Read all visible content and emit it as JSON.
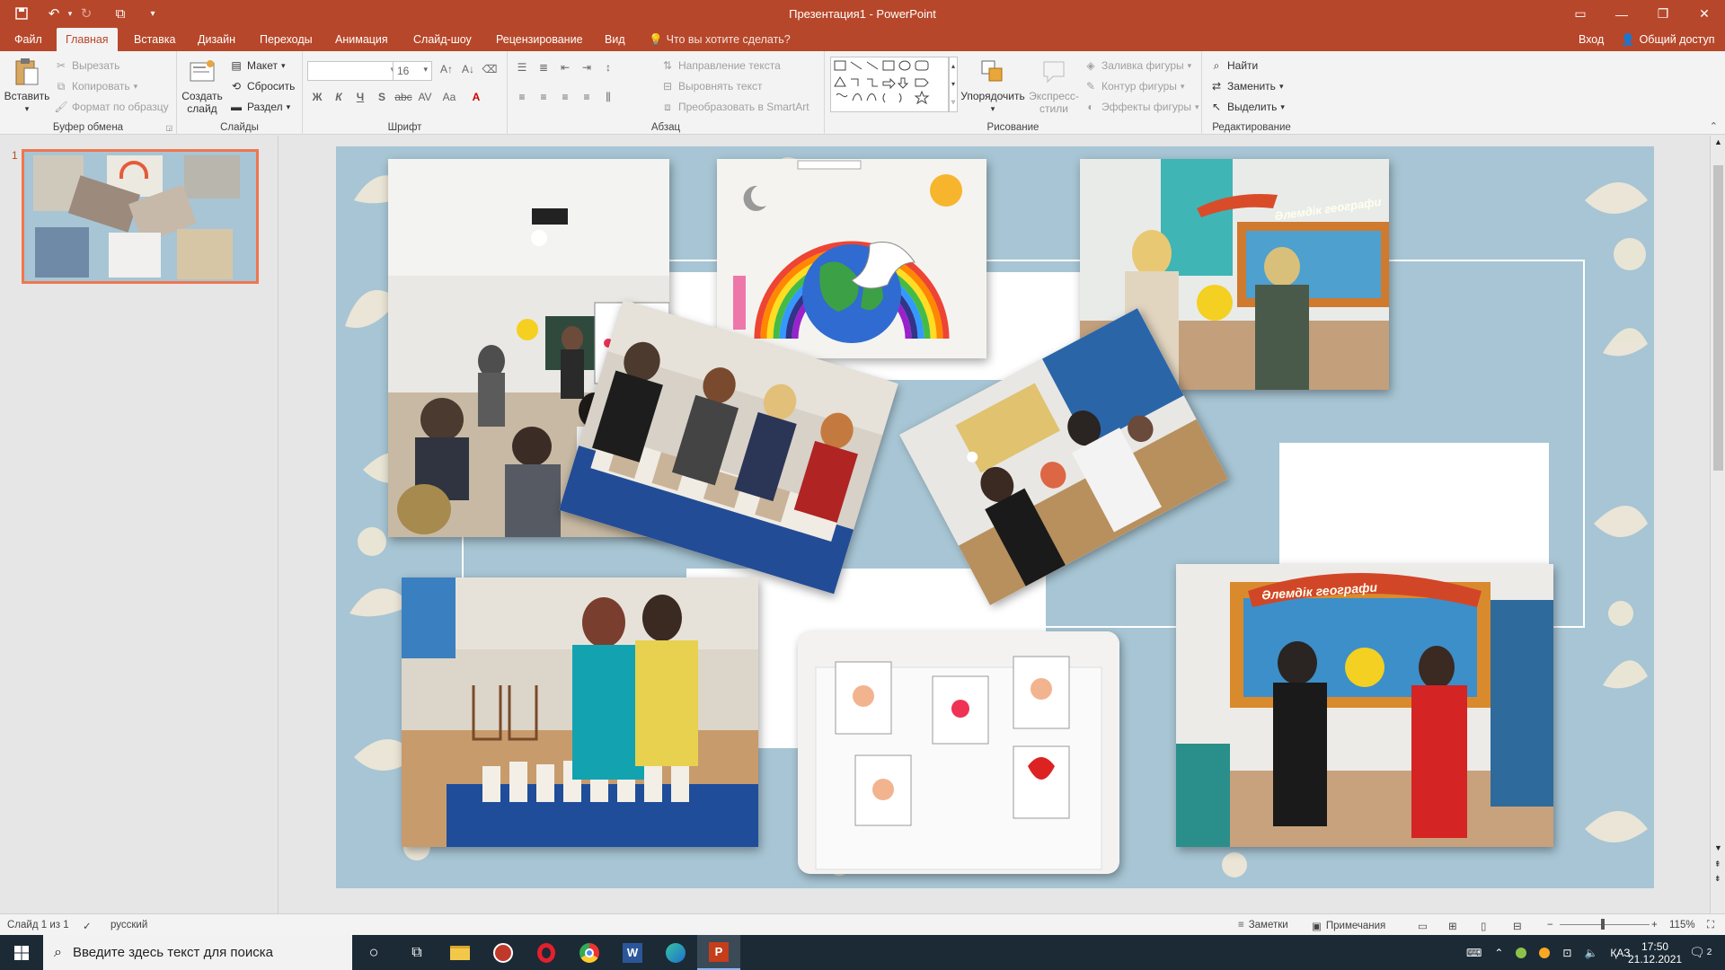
{
  "titlebar": {
    "title": "Презентация1 - PowerPoint"
  },
  "tabs": [
    {
      "label": "Файл"
    },
    {
      "label": "Главная"
    },
    {
      "label": "Вставка"
    },
    {
      "label": "Дизайн"
    },
    {
      "label": "Переходы"
    },
    {
      "label": "Анимация"
    },
    {
      "label": "Слайд-шоу"
    },
    {
      "label": "Рецензирование"
    },
    {
      "label": "Вид"
    }
  ],
  "tellme": "Что вы хотите сделать?",
  "account": {
    "signin": "Вход",
    "share": "Общий доступ"
  },
  "clipboard": {
    "paste": "Вставить",
    "cut": "Вырезать",
    "copy": "Копировать",
    "painter": "Формат по образцу",
    "label": "Буфер обмена"
  },
  "slides": {
    "new_line1": "Создать",
    "new_line2": "слайд",
    "layout": "Макет",
    "reset": "Сбросить",
    "section": "Раздел",
    "label": "Слайды"
  },
  "font": {
    "size": "16",
    "label": "Шрифт",
    "bold": "Ж",
    "italic": "К",
    "underline": "Ч",
    "strike": "S",
    "abc": "abc",
    "spacing": "AV",
    "case": "Aa",
    "color": "A"
  },
  "paragraph": {
    "direction": "Направление текста",
    "align": "Выровнять текст",
    "smartart": "Преобразовать в SmartArt",
    "label": "Абзац"
  },
  "drawing": {
    "arrange": "Упорядочить",
    "styles_line1": "Экспресс-",
    "styles_line2": "стили",
    "fill": "Заливка фигуры",
    "outline": "Контур фигуры",
    "effects": "Эффекты фигуры",
    "label": "Рисование"
  },
  "editing": {
    "find": "Найти",
    "replace": "Заменить",
    "select": "Выделить",
    "label": "Редактирование"
  },
  "thumb_number": "1",
  "status": {
    "slide": "Слайд 1 из 1",
    "lang": "русский",
    "notes": "Заметки",
    "comments": "Примечания",
    "zoom": "115%"
  },
  "slide_text": {
    "banner1": "Әлемдік географи",
    "banner2": "Әлемдік географи"
  },
  "taskbar": {
    "search_placeholder": "Введите здесь текст для поиска",
    "lang": "ҚАЗ",
    "time": "17:50",
    "date": "21.12.2021",
    "notif": "2"
  }
}
